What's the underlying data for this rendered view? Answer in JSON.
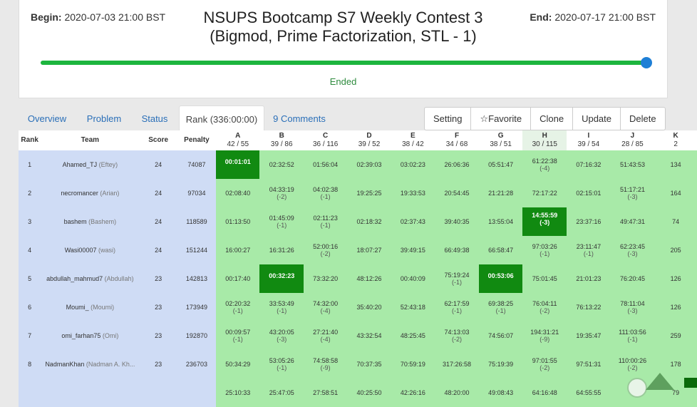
{
  "contest": {
    "begin_label": "Begin:",
    "begin_value": "2020-07-03 21:00 BST",
    "end_label": "End:",
    "end_value": "2020-07-17 21:00 BST",
    "title_line1": "NSUPS Bootcamp S7 Weekly Contest 3",
    "title_line2": "(Bigmod, Prime Factorization, STL - 1)",
    "progress_fraction": 1.0,
    "status": "Ended"
  },
  "tabs": [
    {
      "label": "Overview"
    },
    {
      "label": "Problem"
    },
    {
      "label": "Status"
    },
    {
      "label": "Rank (336:00:00)"
    },
    {
      "label": "9 Comments"
    }
  ],
  "actions": {
    "setting": "Setting",
    "favorite": "Favorite",
    "favorite_icon": "☆",
    "clone": "Clone",
    "update": "Update",
    "delete": "Delete"
  },
  "colors": {
    "accepted": "#a8eaa8",
    "first_solve": "#118a11",
    "team_info": "#cfdcf5",
    "progress": "#1db53e",
    "link": "#2a6fb8"
  },
  "table": {
    "headers": {
      "rank": "Rank",
      "team": "Team",
      "score": "Score",
      "penalty": "Penalty"
    },
    "problems": [
      {
        "id": "A",
        "ratio": "42 / 55"
      },
      {
        "id": "B",
        "ratio": "39 / 86"
      },
      {
        "id": "C",
        "ratio": "36 / 116"
      },
      {
        "id": "D",
        "ratio": "39 / 52"
      },
      {
        "id": "E",
        "ratio": "38 / 42"
      },
      {
        "id": "F",
        "ratio": "34 / 68"
      },
      {
        "id": "G",
        "ratio": "38 / 51"
      },
      {
        "id": "H",
        "ratio": "30 / 115"
      },
      {
        "id": "I",
        "ratio": "39 / 54"
      },
      {
        "id": "J",
        "ratio": "28 / 85"
      },
      {
        "id": "K",
        "ratio": "2"
      }
    ],
    "rows": [
      {
        "rank": "1",
        "team": "Ahamed_TJ",
        "name": "(Eftey)",
        "score": "24",
        "penalty": "74087",
        "cells": [
          {
            "t": "00:01:01",
            "p": "",
            "first": true
          },
          {
            "t": "02:32:52",
            "p": ""
          },
          {
            "t": "01:56:04",
            "p": ""
          },
          {
            "t": "02:39:03",
            "p": ""
          },
          {
            "t": "03:02:23",
            "p": ""
          },
          {
            "t": "26:06:36",
            "p": ""
          },
          {
            "t": "05:51:47",
            "p": ""
          },
          {
            "t": "61:22:38",
            "p": "(-4)"
          },
          {
            "t": "07:16:32",
            "p": ""
          },
          {
            "t": "51:43:53",
            "p": ""
          },
          {
            "t": "134",
            "p": ""
          }
        ]
      },
      {
        "rank": "2",
        "team": "necromancer",
        "name": "(Arian)",
        "score": "24",
        "penalty": "97034",
        "cells": [
          {
            "t": "02:08:40",
            "p": ""
          },
          {
            "t": "04:33:19",
            "p": "(-2)"
          },
          {
            "t": "04:02:38",
            "p": "(-1)"
          },
          {
            "t": "19:25:25",
            "p": ""
          },
          {
            "t": "19:33:53",
            "p": ""
          },
          {
            "t": "20:54:45",
            "p": ""
          },
          {
            "t": "21:21:28",
            "p": ""
          },
          {
            "t": "72:17:22",
            "p": ""
          },
          {
            "t": "02:15:01",
            "p": ""
          },
          {
            "t": "51:17:21",
            "p": "(-3)"
          },
          {
            "t": "164",
            "p": ""
          }
        ]
      },
      {
        "rank": "3",
        "team": "bashem",
        "name": "(Bashem)",
        "score": "24",
        "penalty": "118589",
        "cells": [
          {
            "t": "01:13:50",
            "p": ""
          },
          {
            "t": "01:45:09",
            "p": "(-1)"
          },
          {
            "t": "02:11:23",
            "p": "(-1)"
          },
          {
            "t": "02:18:32",
            "p": ""
          },
          {
            "t": "02:37:43",
            "p": ""
          },
          {
            "t": "39:40:35",
            "p": ""
          },
          {
            "t": "13:55:04",
            "p": ""
          },
          {
            "t": "14:55:59",
            "p": "(-3)",
            "first": true
          },
          {
            "t": "23:37:16",
            "p": ""
          },
          {
            "t": "49:47:31",
            "p": ""
          },
          {
            "t": "74",
            "p": ""
          }
        ]
      },
      {
        "rank": "4",
        "team": "Wasi00007",
        "name": "(wasi)",
        "score": "24",
        "penalty": "151244",
        "cells": [
          {
            "t": "16:00:27",
            "p": ""
          },
          {
            "t": "16:31:26",
            "p": ""
          },
          {
            "t": "52:00:16",
            "p": "(-2)"
          },
          {
            "t": "18:07:27",
            "p": ""
          },
          {
            "t": "39:49:15",
            "p": ""
          },
          {
            "t": "66:49:38",
            "p": ""
          },
          {
            "t": "66:58:47",
            "p": ""
          },
          {
            "t": "97:03:26",
            "p": "(-1)"
          },
          {
            "t": "23:11:47",
            "p": "(-1)"
          },
          {
            "t": "62:23:45",
            "p": "(-3)"
          },
          {
            "t": "205",
            "p": ""
          }
        ]
      },
      {
        "rank": "5",
        "team": "abdullah_mahmud7",
        "name": "(Abdullah)",
        "score": "23",
        "penalty": "142813",
        "cells": [
          {
            "t": "00:17:40",
            "p": ""
          },
          {
            "t": "00:32:23",
            "p": "",
            "first": true
          },
          {
            "t": "73:32:20",
            "p": ""
          },
          {
            "t": "48:12:26",
            "p": ""
          },
          {
            "t": "00:40:09",
            "p": ""
          },
          {
            "t": "75:19:24",
            "p": "(-1)"
          },
          {
            "t": "00:53:06",
            "p": "",
            "first": true
          },
          {
            "t": "75:01:45",
            "p": ""
          },
          {
            "t": "21:01:23",
            "p": ""
          },
          {
            "t": "76:20:45",
            "p": ""
          },
          {
            "t": "126",
            "p": ""
          }
        ]
      },
      {
        "rank": "6",
        "team": "Moumi_",
        "name": "(Moumi)",
        "score": "23",
        "penalty": "173949",
        "cells": [
          {
            "t": "02:20:32",
            "p": "(-1)"
          },
          {
            "t": "33:53:49",
            "p": "(-1)"
          },
          {
            "t": "74:32:00",
            "p": "(-4)"
          },
          {
            "t": "35:40:20",
            "p": ""
          },
          {
            "t": "52:43:18",
            "p": ""
          },
          {
            "t": "62:17:59",
            "p": "(-1)"
          },
          {
            "t": "69:38:25",
            "p": "(-1)"
          },
          {
            "t": "76:04:11",
            "p": "(-2)"
          },
          {
            "t": "76:13:22",
            "p": ""
          },
          {
            "t": "78:11:04",
            "p": "(-3)"
          },
          {
            "t": "126",
            "p": ""
          }
        ]
      },
      {
        "rank": "7",
        "team": "omi_farhan75",
        "name": "(Omi)",
        "score": "23",
        "penalty": "192870",
        "cells": [
          {
            "t": "00:09:57",
            "p": "(-1)"
          },
          {
            "t": "43:20:05",
            "p": "(-3)"
          },
          {
            "t": "27:21:40",
            "p": "(-4)"
          },
          {
            "t": "43:32:54",
            "p": ""
          },
          {
            "t": "48:25:45",
            "p": ""
          },
          {
            "t": "74:13:03",
            "p": "(-2)"
          },
          {
            "t": "74:56:07",
            "p": ""
          },
          {
            "t": "194:31:21",
            "p": "(-9)"
          },
          {
            "t": "19:35:47",
            "p": ""
          },
          {
            "t": "111:03:56",
            "p": "(-1)"
          },
          {
            "t": "259",
            "p": ""
          }
        ]
      },
      {
        "rank": "8",
        "team": "NadmanKhan",
        "name": "(Nadman A. Kh...",
        "score": "23",
        "penalty": "236703",
        "cells": [
          {
            "t": "50:34:29",
            "p": ""
          },
          {
            "t": "53:05:26",
            "p": "(-1)"
          },
          {
            "t": "74:58:58",
            "p": "(-9)"
          },
          {
            "t": "70:37:35",
            "p": ""
          },
          {
            "t": "70:59:19",
            "p": ""
          },
          {
            "t": "317:26:58",
            "p": ""
          },
          {
            "t": "75:19:39",
            "p": ""
          },
          {
            "t": "97:01:55",
            "p": "(-2)"
          },
          {
            "t": "97:51:31",
            "p": ""
          },
          {
            "t": "110:00:26",
            "p": "(-2)"
          },
          {
            "t": "178",
            "p": ""
          }
        ]
      },
      {
        "rank": "",
        "team": "",
        "name": "",
        "score": "",
        "penalty": "",
        "cells": [
          {
            "t": "25:10:33",
            "p": ""
          },
          {
            "t": "25:47:05",
            "p": ""
          },
          {
            "t": "27:58:51",
            "p": ""
          },
          {
            "t": "40:25:50",
            "p": ""
          },
          {
            "t": "42:26:16",
            "p": ""
          },
          {
            "t": "48:20:00",
            "p": ""
          },
          {
            "t": "49:08:43",
            "p": ""
          },
          {
            "t": "64:16:48",
            "p": ""
          },
          {
            "t": "64:55:55",
            "p": ""
          },
          {
            "t": "",
            "p": ""
          },
          {
            "t": "79",
            "p": ""
          }
        ]
      }
    ]
  }
}
